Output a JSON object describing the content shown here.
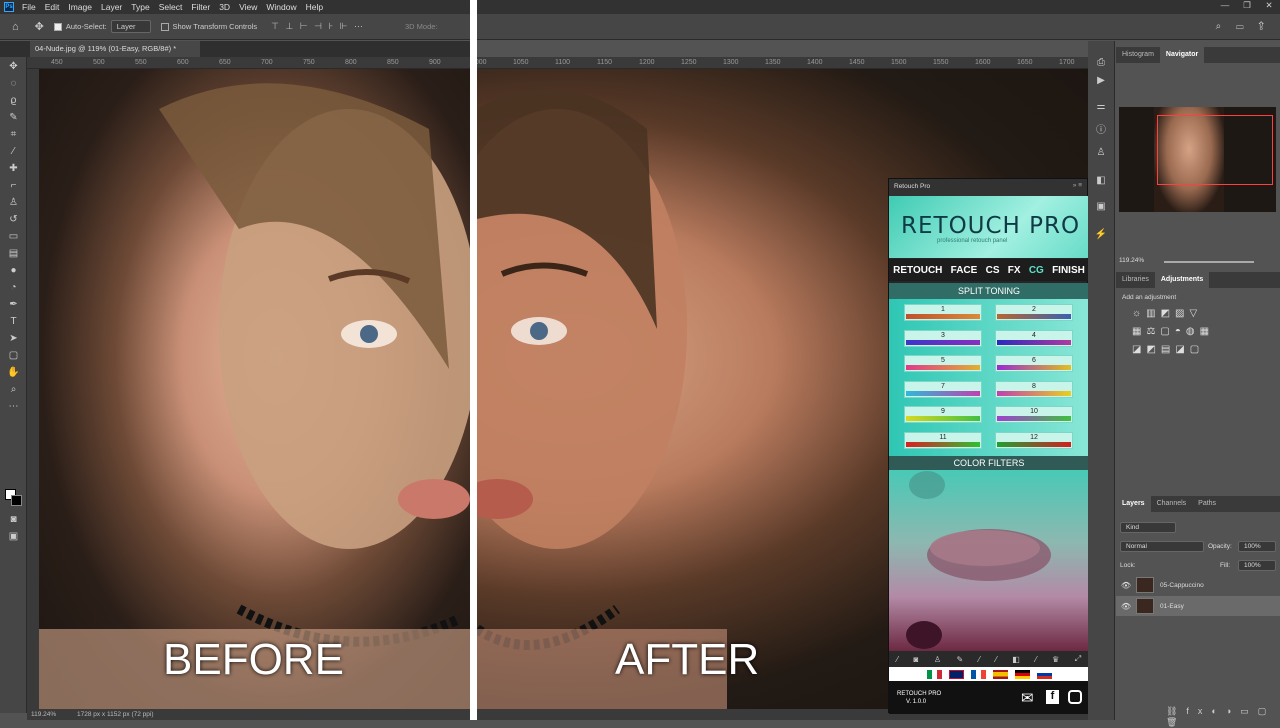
{
  "menubar": {
    "logo": "Ps",
    "items": [
      "File",
      "Edit",
      "Image",
      "Layer",
      "Type",
      "Select",
      "Filter",
      "3D",
      "View",
      "Window",
      "Help"
    ],
    "window_controls": [
      "—",
      "❐",
      "✕"
    ]
  },
  "options": {
    "auto_select_label": "Auto-Select:",
    "auto_select_value": "Layer",
    "transform_label": "Show Transform Controls",
    "mode_label": "3D Mode:"
  },
  "document": {
    "tab_title": "04-Nude.jpg @ 119% (01-Easy, RGB/8#) *",
    "ruler_ticks": [
      "450",
      "500",
      "550",
      "600",
      "650",
      "700",
      "750",
      "800",
      "850",
      "900",
      "1000",
      "1050",
      "1100",
      "1150",
      "1200",
      "1250",
      "1300",
      "1350",
      "1400",
      "1450",
      "1500",
      "1550",
      "1600",
      "1650",
      "1700"
    ],
    "zoom": "119.24%",
    "size_info": "1728 px x 1152 px (72 ppi)"
  },
  "overlay": {
    "before_label": "BEFORE",
    "after_label": "AFTER"
  },
  "retouch_panel": {
    "header": "Retouch Pro",
    "title": "RETOUCH PRO",
    "subtitle": "professional retouch panel",
    "nav": [
      "RETOUCH",
      "FACE",
      "CS",
      "FX",
      "CG",
      "FINISH"
    ],
    "split_toning_label": "SPLIT TONING",
    "swatches": [
      {
        "n": "1",
        "c1": "#c0502d",
        "c2": "#d98a3a"
      },
      {
        "n": "2",
        "c1": "#b8672f",
        "c2": "#3a5fb0"
      },
      {
        "n": "3",
        "c1": "#3b36c9",
        "c2": "#8a2dc0"
      },
      {
        "n": "4",
        "c1": "#2a2ac0",
        "c2": "#b03aa0"
      },
      {
        "n": "5",
        "c1": "#e03a8a",
        "c2": "#e0b030"
      },
      {
        "n": "6",
        "c1": "#9a2ad0",
        "c2": "#e0c020"
      },
      {
        "n": "7",
        "c1": "#30b8d8",
        "c2": "#c040b0"
      },
      {
        "n": "8",
        "c1": "#c040b0",
        "c2": "#e8d020"
      },
      {
        "n": "9",
        "c1": "#d8d820",
        "c2": "#40c040"
      },
      {
        "n": "10",
        "c1": "#a040d0",
        "c2": "#40c040"
      },
      {
        "n": "11",
        "c1": "#d82020",
        "c2": "#30c030"
      },
      {
        "n": "12",
        "c1": "#20a030",
        "c2": "#d02020"
      }
    ],
    "color_filters_label": "COLOR FILTERS",
    "footer_title": "RETOUCH PRO",
    "footer_version": "V. 1.0.0"
  },
  "navigator": {
    "tabs": [
      "Histogram",
      "Navigator"
    ],
    "zoom": "119.24%"
  },
  "adjustments": {
    "tabs": [
      "Libraries",
      "Adjustments"
    ],
    "hint": "Add an adjustment"
  },
  "layers": {
    "tabs": [
      "Layers",
      "Channels",
      "Paths"
    ],
    "filter": "Kind",
    "blend_mode": "Normal",
    "opacity_label": "Opacity:",
    "opacity": "100%",
    "lock_label": "Lock:",
    "fill_label": "Fill:",
    "fill": "100%",
    "rows": [
      {
        "name": "05-Cappuccino"
      },
      {
        "name": "01-Easy"
      }
    ]
  },
  "colors": {
    "accent": "#31a8ff",
    "panel_bg": "#535353",
    "retouch_teal": "#3fcbb3"
  }
}
